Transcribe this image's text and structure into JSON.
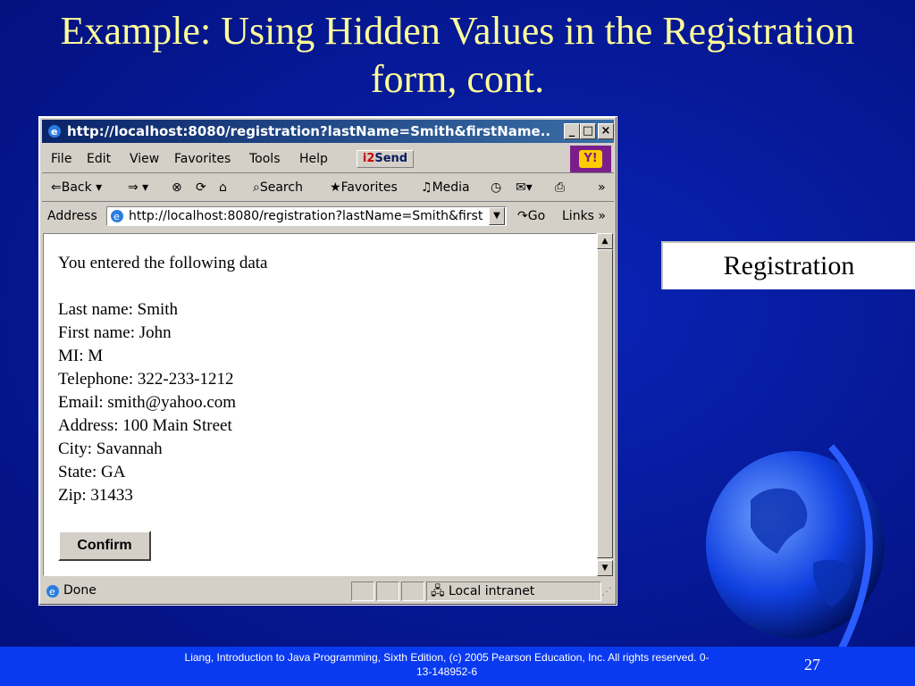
{
  "slide": {
    "title": "Example: Using Hidden Values in the Registration form, cont.",
    "registration_button": "Registration",
    "footer": "Liang, Introduction to Java Programming, Sixth Edition, (c) 2005 Pearson Education, Inc. All rights reserved. 0-13-148952-6",
    "page_number": "27"
  },
  "browser": {
    "title": "http://localhost:8080/registration?lastName=Smith&firstName...",
    "menu": [
      "File",
      "Edit",
      "View",
      "Favorites",
      "Tools",
      "Help"
    ],
    "i2send": "Send",
    "toolbar": {
      "back": "Back",
      "search": "Search",
      "favorites": "Favorites",
      "media": "Media"
    },
    "address_label": "Address",
    "address_value": "http://localhost:8080/registration?lastName=Smith&first",
    "go": "Go",
    "links": "Links",
    "status": "Done",
    "zone": "Local intranet"
  },
  "page": {
    "heading": "You entered the following data",
    "lines": [
      "Last name: Smith",
      "First name: John",
      "MI: M",
      "Telephone: 322-233-1212",
      "Email: smith@yahoo.com",
      "Address: 100 Main Street",
      "City: Savannah",
      "State: GA",
      "Zip: 31433"
    ],
    "confirm_button": "Confirm"
  },
  "colors": {
    "background": "#061a9a",
    "title_text": "#ffff99",
    "footer_bar": "#0a3af0",
    "titlebar": "#0a246a"
  }
}
